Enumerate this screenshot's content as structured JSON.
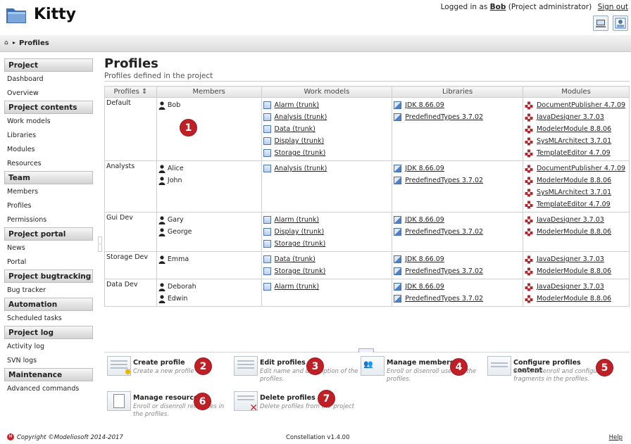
{
  "app": {
    "title": "Kitty"
  },
  "header": {
    "logged_in_as": "Logged in as",
    "user": "Bob",
    "role": "(Project administrator)",
    "sign_out": "Sign out"
  },
  "breadcrumb": {
    "current": "Profiles"
  },
  "sidebar": {
    "sections": [
      {
        "title": "Project",
        "items": [
          "Dashboard",
          "Overview"
        ]
      },
      {
        "title": "Project contents",
        "items": [
          "Work models",
          "Libraries",
          "Modules",
          "Resources"
        ]
      },
      {
        "title": "Team",
        "items": [
          "Members",
          "Profiles",
          "Permissions"
        ]
      },
      {
        "title": "Project portal",
        "items": [
          "News",
          "Portal"
        ]
      },
      {
        "title": "Project bugtracking",
        "items": [
          "Bug tracker"
        ]
      },
      {
        "title": "Automation",
        "items": [
          "Scheduled tasks"
        ]
      },
      {
        "title": "Project log",
        "items": [
          "Activity log",
          "SVN logs"
        ]
      },
      {
        "title": "Maintenance",
        "items": [
          "Advanced commands"
        ]
      }
    ]
  },
  "main": {
    "title": "Profiles",
    "subtitle": "Profiles defined in the project",
    "columns": [
      "Profiles ⇕",
      "Members",
      "Work models",
      "Libraries",
      "Modules"
    ],
    "rows": [
      {
        "profile": "Default",
        "members": [
          "Bob"
        ],
        "work_models": [
          "Alarm (trunk)",
          "Analysis (trunk)",
          "Data (trunk)",
          "Display (trunk)",
          "Storage (trunk)"
        ],
        "libraries": [
          "JDK 8.66.09",
          "PredefinedTypes 3.7.02"
        ],
        "modules": [
          "DocumentPublisher 4.7.09",
          "JavaDesigner 3.7.03",
          "ModelerModule 8.8.06",
          "SysMLArchitect 3.7.01",
          "TemplateEditor 4.7.09"
        ]
      },
      {
        "profile": "Analysts",
        "members": [
          "Alice",
          "John"
        ],
        "work_models": [
          "Analysis (trunk)"
        ],
        "libraries": [
          "JDK 8.66.09",
          "PredefinedTypes 3.7.02"
        ],
        "modules": [
          "DocumentPublisher 4.7.09",
          "ModelerModule 8.8.06",
          "SysMLArchitect 3.7.01",
          "TemplateEditor 4.7.09"
        ]
      },
      {
        "profile": "Gui Dev",
        "members": [
          "Gary",
          "George"
        ],
        "work_models": [
          "Alarm (trunk)",
          "Display (trunk)",
          "Storage (trunk)"
        ],
        "libraries": [
          "JDK 8.66.09",
          "PredefinedTypes 3.7.02"
        ],
        "modules": [
          "JavaDesigner 3.7.03",
          "ModelerModule 8.8.06"
        ]
      },
      {
        "profile": "Storage Dev",
        "members": [
          "Emma"
        ],
        "work_models": [
          "Data (trunk)",
          "Storage (trunk)"
        ],
        "libraries": [
          "JDK 8.66.09",
          "PredefinedTypes 3.7.02"
        ],
        "modules": [
          "JavaDesigner 3.7.03",
          "ModelerModule 8.8.06"
        ]
      },
      {
        "profile": "Data Dev",
        "members": [
          "Deborah",
          "Edwin"
        ],
        "work_models": [
          "Alarm (trunk)"
        ],
        "libraries": [
          "JDK 8.66.09",
          "PredefinedTypes 3.7.02"
        ],
        "modules": [
          "JavaDesigner 3.7.03",
          "ModelerModule 8.8.06"
        ]
      }
    ]
  },
  "annotations": [
    "1",
    "2",
    "3",
    "4",
    "5",
    "6",
    "7"
  ],
  "actions": [
    {
      "label": "Create profile",
      "desc": "Create a new profile"
    },
    {
      "label": "Edit profiles",
      "desc": "Edit name and description of the profiles."
    },
    {
      "label": "Manage members",
      "desc": "Enroll or disenroll users in the profiles."
    },
    {
      "label": "Configure profiles content",
      "desc": "Enroll, disenroll and configure fragments in the profiles."
    },
    {
      "label": "Manage resources",
      "desc": "Enroll or disenroll resources in the profiles."
    },
    {
      "label": "Delete profiles",
      "desc": "Delete profiles from the project"
    }
  ],
  "footer": {
    "copyright": "Copyright ©Modeliosoft 2014-2017",
    "version": "Constellation v1.4.00",
    "help": "Help"
  },
  "colors": {
    "badge": "#bf2026",
    "module_icon": "#b3262b",
    "link_icon": "#4a74b4"
  }
}
